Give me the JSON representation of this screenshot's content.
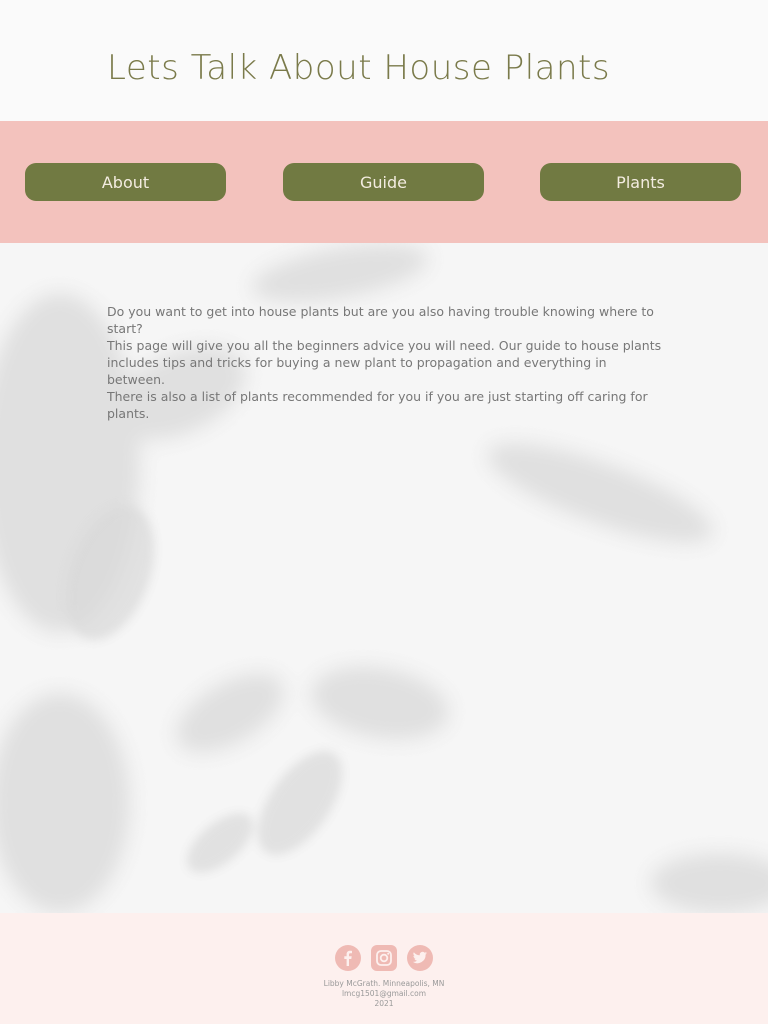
{
  "header": {
    "title": "Lets Talk About House Plants"
  },
  "nav": {
    "items": [
      {
        "label": "About"
      },
      {
        "label": "Guide"
      },
      {
        "label": "Plants"
      }
    ]
  },
  "intro": {
    "paragraphs": [
      "Do you want to get into house plants but are you also having trouble knowing where to start?",
      "This page will give you all the beginners advice you will need. Our guide to house plants includes tips and tricks for buying a new plant to propagation and everything in between.",
      "There is also a list of plants recommended for you if you are just starting off caring for plants."
    ]
  },
  "footer": {
    "social": [
      {
        "icon": "facebook-icon"
      },
      {
        "icon": "instagram-icon"
      },
      {
        "icon": "twitter-icon"
      }
    ],
    "line1": "Libby McGrath. Minneapolis, MN",
    "line2": "lmcg1501@gmail.com",
    "line3": "2021"
  },
  "colors": {
    "nav_band": "#f3c2bd",
    "button": "#717a42",
    "footer": "#fdf0ee",
    "social_icon": "#efbab4"
  }
}
